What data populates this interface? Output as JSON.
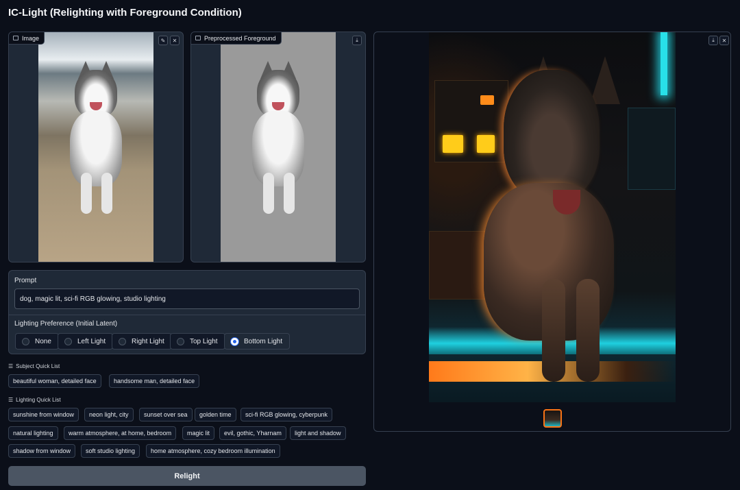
{
  "app": {
    "title": "IC-Light (Relighting with Foreground Condition)"
  },
  "input_image": {
    "label": "Image",
    "edit_icon": "pencil-icon",
    "close_icon": "close-icon"
  },
  "foreground": {
    "label": "Preprocessed Foreground",
    "download_icon": "download-icon"
  },
  "output": {
    "download_icon": "download-icon",
    "close_icon": "close-icon"
  },
  "prompt": {
    "label": "Prompt",
    "value": "dog, magic lit, sci-fi RGB glowing, studio lighting"
  },
  "lighting": {
    "label": "Lighting Preference (Initial Latent)",
    "options": [
      "None",
      "Left Light",
      "Right Light",
      "Top Light",
      "Bottom Light"
    ],
    "selected": "Bottom Light"
  },
  "subject_quick_list": {
    "title": "Subject Quick List",
    "items": [
      "beautiful woman, detailed face",
      "handsome man, detailed face"
    ]
  },
  "lighting_quick_list": {
    "title": "Lighting Quick List",
    "items": [
      "sunshine from window",
      "neon light, city",
      "sunset over sea",
      "golden time",
      "sci-fi RGB glowing, cyberpunk",
      "natural lighting",
      "warm atmosphere, at home, bedroom",
      "magic lit",
      "evil, gothic, Yharnam",
      "light and shadow",
      "shadow from window",
      "soft studio lighting",
      "home atmosphere, cozy bedroom illumination"
    ]
  },
  "actions": {
    "relight_label": "Relight"
  },
  "colors": {
    "background": "#0b0f19",
    "panel": "#1f2937",
    "accent": "#2563eb",
    "thumb_border": "#f97316"
  }
}
